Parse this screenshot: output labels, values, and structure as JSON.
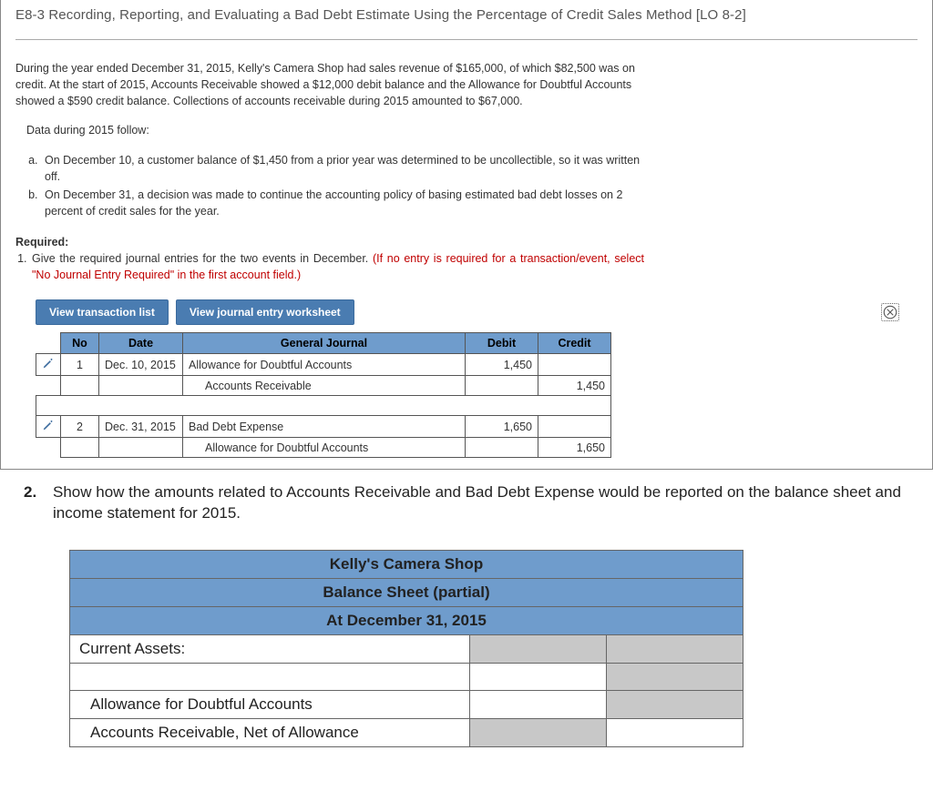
{
  "title": "E8-3 Recording, Reporting, and Evaluating a Bad Debt Estimate Using the Percentage of Credit Sales Method [LO 8-2]",
  "intro": "During the year ended December 31, 2015, Kelly's Camera Shop had sales revenue of $165,000, of which $82,500 was on credit. At the start of 2015, Accounts Receivable showed a $12,000 debit balance and the Allowance for Doubtful Accounts showed a $590 credit balance. Collections of accounts receivable during 2015 amounted to $67,000.",
  "data_follow": "Data during 2015 follow:",
  "events": [
    "On December 10, a customer balance of $1,450 from a prior year was determined to be uncollectible, so it was written off.",
    "On December 31, a decision was made to continue the accounting policy of basing estimated bad debt losses on 2 percent of credit sales for the year."
  ],
  "required_label": "Required:",
  "req1_black": "Give the required journal entries for the two events in December. ",
  "req1_red": "(If no entry is required for a transaction/event, select \"No Journal Entry Required\" in the first account field.)",
  "buttons": {
    "view_list": "View transaction list",
    "view_ws": "View journal entry worksheet"
  },
  "journal": {
    "headers": {
      "no": "No",
      "date": "Date",
      "gj": "General Journal",
      "debit": "Debit",
      "credit": "Credit"
    },
    "rows": [
      {
        "edit": true,
        "no": "1",
        "date": "Dec. 10, 2015",
        "account": "Allowance for Doubtful Accounts",
        "indent": false,
        "debit": "1,450",
        "credit": ""
      },
      {
        "edit": false,
        "no": "",
        "date": "",
        "account": "Accounts Receivable",
        "indent": true,
        "debit": "",
        "credit": "1,450"
      }
    ],
    "rows2": [
      {
        "edit": true,
        "no": "2",
        "date": "Dec. 31, 2015",
        "account": "Bad Debt Expense",
        "indent": false,
        "debit": "1,650",
        "credit": ""
      },
      {
        "edit": false,
        "no": "",
        "date": "",
        "account": "Allowance for Doubtful Accounts",
        "indent": true,
        "debit": "",
        "credit": "1,650"
      }
    ]
  },
  "part2": {
    "num": "2.",
    "text": "Show how the amounts related to Accounts Receivable and Bad Debt Expense would be reported on the balance sheet and income statement for 2015."
  },
  "balance": {
    "h1": "Kelly's Camera Shop",
    "h2": "Balance Sheet (partial)",
    "h3": "At December 31, 2015",
    "lines": [
      "Current Assets:",
      "",
      "Allowance for Doubtful Accounts",
      "Accounts Receivable, Net of Allowance"
    ]
  }
}
